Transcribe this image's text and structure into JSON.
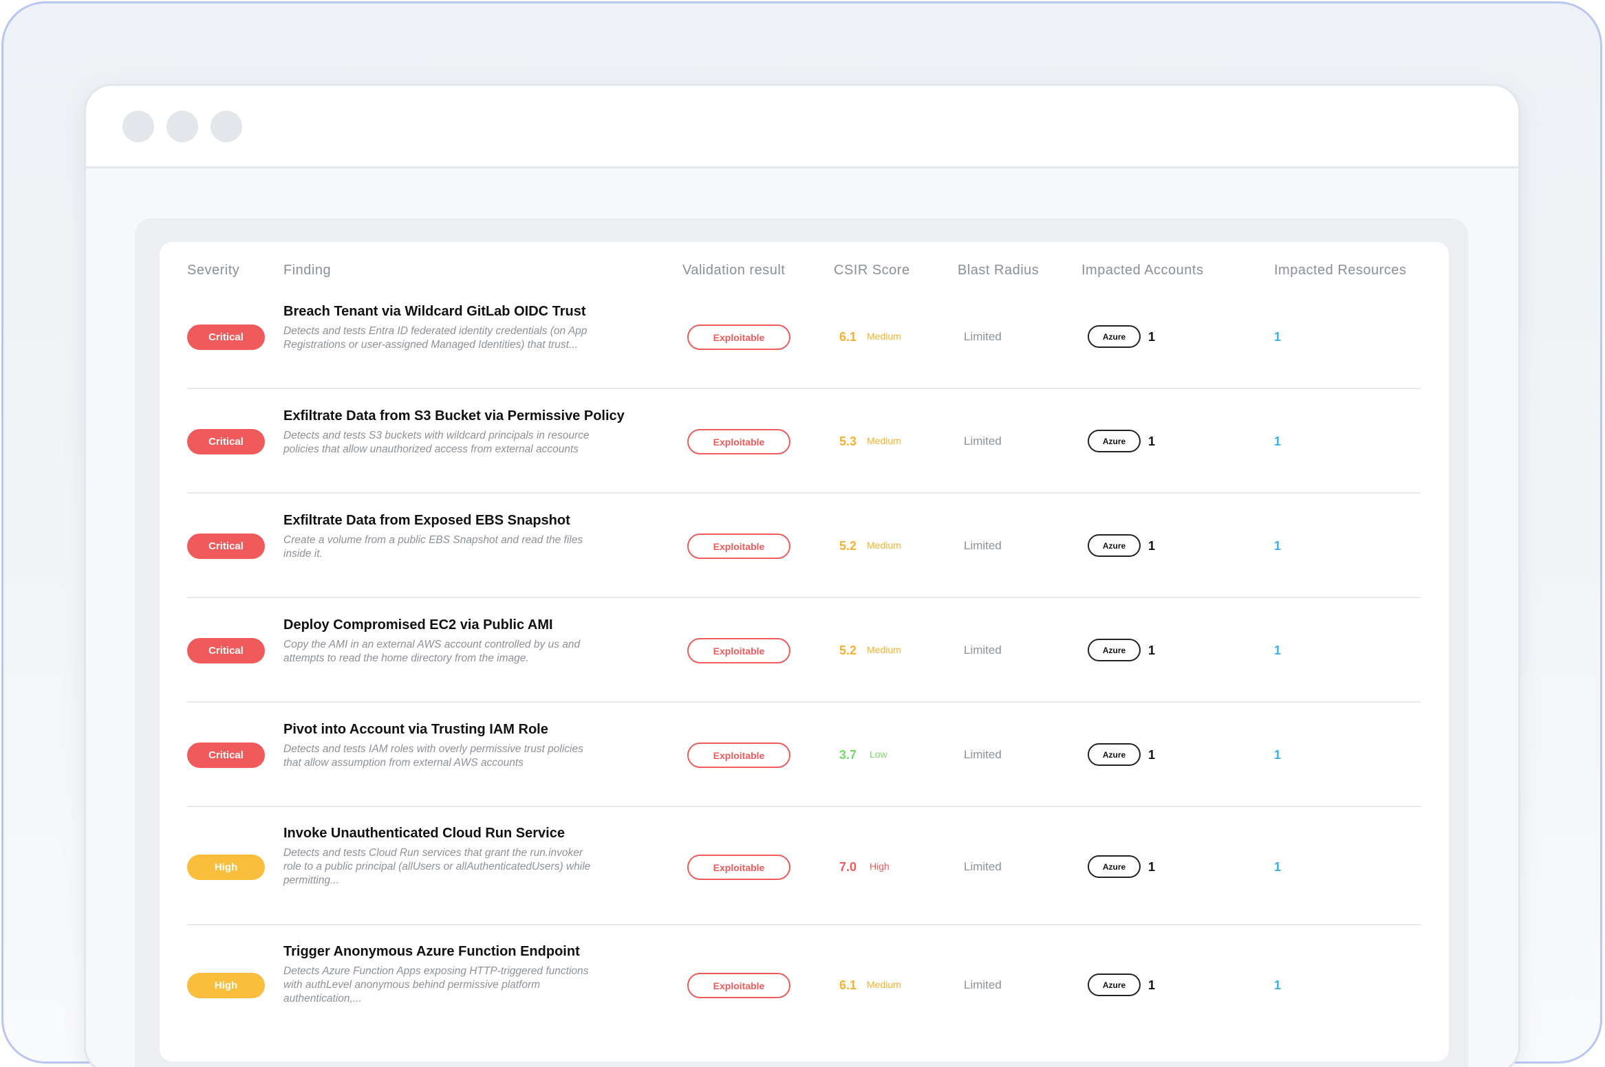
{
  "columns": {
    "severity": "Severity",
    "finding": "Finding",
    "validation": "Validation result",
    "csir": "CSIR Score",
    "blast": "Blast Radius",
    "accounts": "Impacted Accounts",
    "resources": "Impacted Resources"
  },
  "colors": {
    "critical": "#f05a5a",
    "high": "#fbbd3c",
    "medium": "#f5b22e",
    "low": "#78d96b",
    "score_high": "#f05a5a",
    "resources": "#3ab0e8"
  },
  "rows": [
    {
      "severity": "Critical",
      "title": "Breach Tenant via Wildcard GitLab OIDC Trust",
      "desc1": "Detects and tests Entra ID federated identity credentials (on App",
      "desc2": "Registrations or user-assigned Managed Identities) that trust...",
      "desc3": "",
      "validation": "Exploitable",
      "score": "6.1",
      "score_label": "Medium",
      "blast": "Limited",
      "cloud": "Azure",
      "accounts": "1",
      "resources": "1"
    },
    {
      "severity": "Critical",
      "title": "Exfiltrate Data from S3 Bucket via Permissive Policy",
      "desc1": "Detects and tests S3 buckets with wildcard principals in resource",
      "desc2": "policies that allow unauthorized access from external accounts",
      "desc3": "",
      "validation": "Exploitable",
      "score": "5.3",
      "score_label": "Medium",
      "blast": "Limited",
      "cloud": "Azure",
      "accounts": "1",
      "resources": "1"
    },
    {
      "severity": "Critical",
      "title": "Exfiltrate Data from Exposed EBS Snapshot",
      "desc1": "Create a volume from a public EBS Snapshot and read the files",
      "desc2": "inside it.",
      "desc3": "",
      "validation": "Exploitable",
      "score": "5.2",
      "score_label": "Medium",
      "blast": "Limited",
      "cloud": "Azure",
      "accounts": "1",
      "resources": "1"
    },
    {
      "severity": "Critical",
      "title": "Deploy Compromised EC2 via Public AMI",
      "desc1": "Copy the AMI in an external AWS account controlled by us and",
      "desc2": "attempts to read the home directory from the image.",
      "desc3": "",
      "validation": "Exploitable",
      "score": "5.2",
      "score_label": "Medium",
      "blast": "Limited",
      "cloud": "Azure",
      "accounts": "1",
      "resources": "1"
    },
    {
      "severity": "Critical",
      "title": "Pivot into Account via Trusting IAM Role",
      "desc1": "Detects and tests IAM roles with overly permissive trust policies",
      "desc2": "that allow assumption from external AWS accounts",
      "desc3": "",
      "validation": "Exploitable",
      "score": "3.7",
      "score_label": "Low",
      "blast": "Limited",
      "cloud": "Azure",
      "accounts": "1",
      "resources": "1"
    },
    {
      "severity": "High",
      "title": "Invoke Unauthenticated Cloud Run Service",
      "desc1": "Detects and tests Cloud Run services that grant the run.invoker",
      "desc2": "role to a public principal (allUsers or allAuthenticatedUsers) while",
      "desc3": "permitting...",
      "validation": "Exploitable",
      "score": "7.0",
      "score_label": "High",
      "blast": "Limited",
      "cloud": "Azure",
      "accounts": "1",
      "resources": "1"
    },
    {
      "severity": "High",
      "title": "Trigger Anonymous Azure Function Endpoint",
      "desc1": "Detects Azure Function Apps exposing HTTP-triggered functions",
      "desc2": "with authLevel anonymous behind permissive platform",
      "desc3": "authentication,...",
      "validation": "Exploitable",
      "score": "6.1",
      "score_label": "Medium",
      "blast": "Limited",
      "cloud": "Azure",
      "accounts": "1",
      "resources": "1"
    }
  ]
}
